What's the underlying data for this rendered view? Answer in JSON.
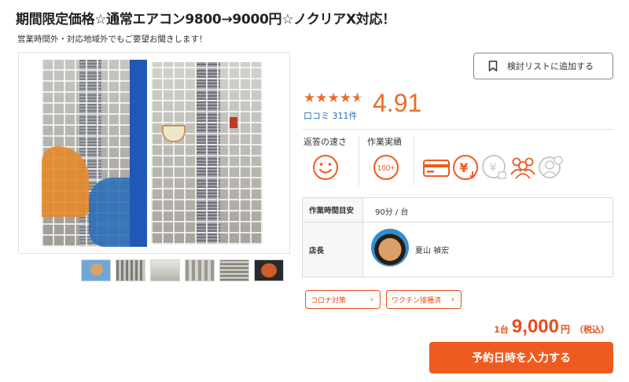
{
  "header": {
    "title": "期間限定価格☆通常エアコン9800→9000円☆ノクリアX対応！",
    "subtitle": "営業時間外・対応地域外でもご要望お聞きします！"
  },
  "gallery": {
    "thumbnail_count": 6
  },
  "favorite": {
    "label": "検討リストに追加する",
    "icon": "bookmark-icon"
  },
  "rating": {
    "value": "4.91",
    "stars": 4.5,
    "reviews_label": "口コミ 311件"
  },
  "metrics": {
    "response_label": "返答の速さ",
    "response_icon": "smile-icon",
    "record_label": "作業実績",
    "record_badge": "100+"
  },
  "payment_icons": [
    "credit-card-icon",
    "yen-transfer-icon",
    "yen-lock-icon",
    "group-icon",
    "consultation-icon"
  ],
  "info_table": {
    "row1_head": "作業時間目安",
    "row1_value": "90分 / 台",
    "row2_head": "店長",
    "row2_value": "夏山 禎宏"
  },
  "tags": [
    {
      "label": "コロナ対策"
    },
    {
      "label": "ワクチン接種済"
    }
  ],
  "price": {
    "unit": "1台",
    "amount": "9,000",
    "yen": "円",
    "tax": "（税込）"
  },
  "cta": {
    "label": "予約日時を入力する"
  },
  "colors": {
    "accent": "#ee5a1f",
    "rating": "#f06a28",
    "link": "#1f6fbe"
  }
}
